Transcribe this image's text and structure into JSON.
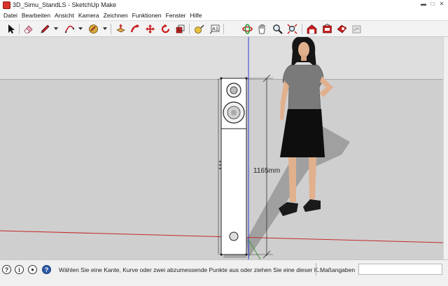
{
  "window": {
    "title": "3D_Simu_StandLS - SketchUp Make",
    "controls": [
      "minimize",
      "maximize",
      "close"
    ]
  },
  "menu": [
    "Datei",
    "Bearbeiten",
    "Ansicht",
    "Kamera",
    "Zeichnen",
    "Funktionen",
    "Fenster",
    "Hilfe"
  ],
  "toolbar": {
    "tools": [
      "select-icon",
      "eraser-icon",
      "pencil-icon",
      "arc-icon",
      "paint-bucket-icon",
      "push-pull-icon",
      "follow-me-icon",
      "move-icon",
      "rotate-icon",
      "scale-icon",
      "tape-measure-icon",
      "text-icon",
      "orbit-icon",
      "pan-icon",
      "zoom-icon",
      "zoom-extents-icon",
      "warehouse-icon",
      "extension-warehouse-icon",
      "share-model-icon"
    ]
  },
  "viewport": {
    "dimension_label": "1165mm",
    "colors": {
      "sky": "#dedede",
      "ground": "#cfcfcf",
      "blue_axis": "#2a3bd6",
      "red_axis": "#c42a2a",
      "green_axis": "#3a9a3a",
      "shadow": "#7a7a7a"
    }
  },
  "status": {
    "hint": "Wählen Sie eine Kante, Kurve oder zwei abzumessende Punkte aus oder ziehen Sie eine dieser K...",
    "measure_label": "Maßangaben",
    "measure_value": ""
  }
}
